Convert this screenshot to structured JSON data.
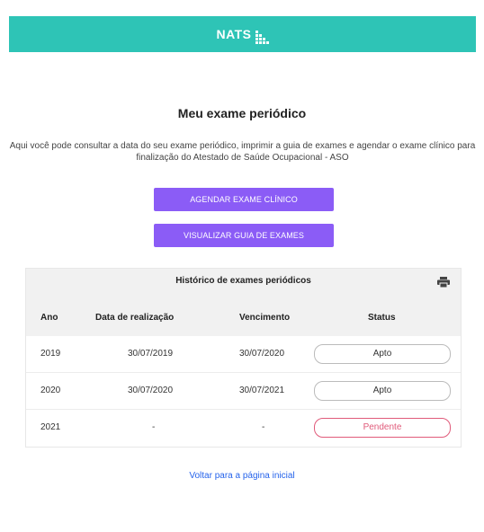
{
  "header": {
    "logo_text": "NATS"
  },
  "main": {
    "title": "Meu exame periódico",
    "description": "Aqui você pode consultar a data do seu exame periódico, imprimir a guia de exames e agendar o exame clínico para finalização do Atestado de Saúde Ocupacional - ASO",
    "buttons": {
      "schedule_label": "AGENDAR EXAME CLÍNICO",
      "view_guide_label": "VISUALIZAR GUIA DE EXAMES"
    }
  },
  "history": {
    "title": "Histórico de exames periódicos",
    "print_icon": "printer-icon",
    "columns": [
      "Ano",
      "Data de realização",
      "Vencimento",
      "Status"
    ],
    "rows": [
      {
        "year": "2019",
        "date": "30/07/2019",
        "due": "30/07/2020",
        "status": "Apto"
      },
      {
        "year": "2020",
        "date": "30/07/2020",
        "due": "30/07/2021",
        "status": "Apto"
      },
      {
        "year": "2021",
        "date": "-",
        "due": "-",
        "status": "Pendente"
      }
    ]
  },
  "footer": {
    "back_link": "Voltar para a página inicial"
  },
  "colors": {
    "topbar": "#2ec4b6",
    "button": "#8b5cf6",
    "link": "#2563eb",
    "pending": "#e05a7a"
  }
}
